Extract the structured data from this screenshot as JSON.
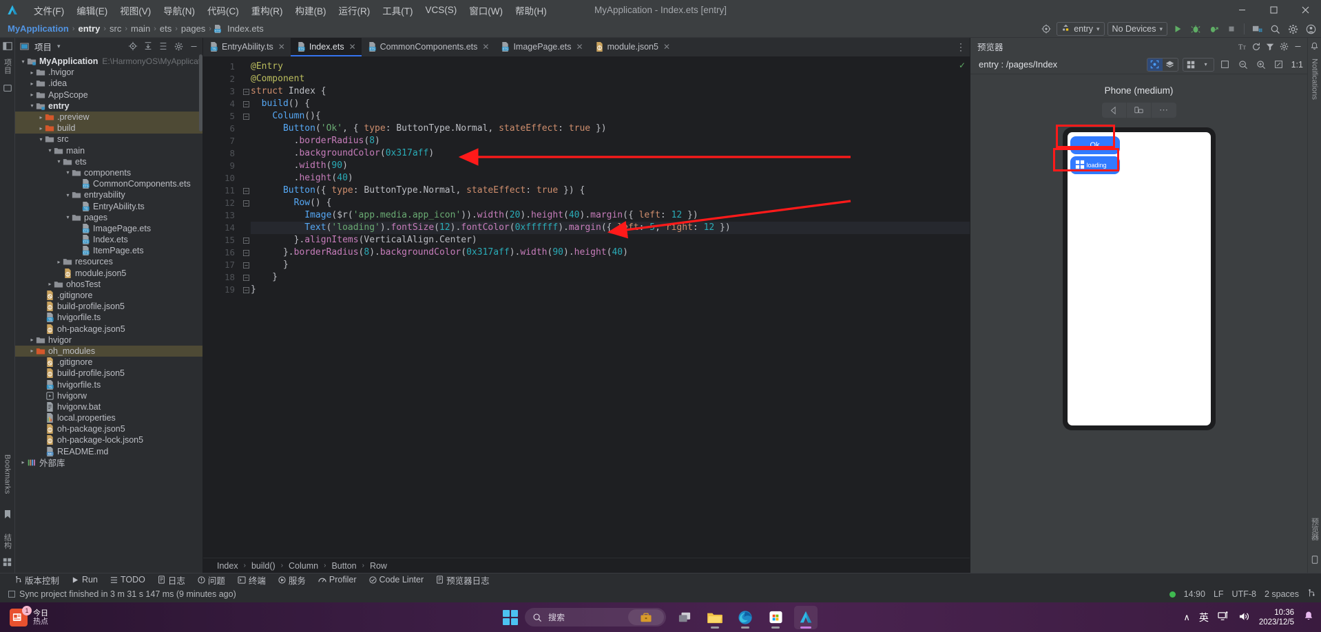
{
  "window": {
    "title": "MyApplication - Index.ets [entry]",
    "minimize": "–",
    "maximize": "☐",
    "close": "✕"
  },
  "menubar": {
    "items": [
      {
        "label": "文件(F)"
      },
      {
        "label": "编辑(E)"
      },
      {
        "label": "视图(V)"
      },
      {
        "label": "导航(N)"
      },
      {
        "label": "代码(C)"
      },
      {
        "label": "重构(R)"
      },
      {
        "label": "构建(B)"
      },
      {
        "label": "运行(R)"
      },
      {
        "label": "工具(T)"
      },
      {
        "label": "VCS(S)"
      },
      {
        "label": "窗口(W)"
      },
      {
        "label": "帮助(H)"
      }
    ]
  },
  "navbar": {
    "breadcrumbs": [
      "MyApplication",
      "entry",
      "src",
      "main",
      "ets",
      "pages",
      "Index.ets"
    ],
    "separator": "›",
    "run_config": "entry",
    "device_select": "No Devices",
    "chevron": "▾"
  },
  "left_rail": {
    "project_label": "项目",
    "bookmarks_label": "Bookmarks",
    "structure_label": "结构"
  },
  "project_panel": {
    "title": "项目",
    "chevron": "▾",
    "tree": [
      {
        "depth": 0,
        "arrow": "⌄",
        "icon": "module",
        "label": "MyApplication",
        "bold": true,
        "path": "E:\\HarmonyOS\\MyApplicatio",
        "selected": false
      },
      {
        "depth": 1,
        "arrow": "›",
        "icon": "folder",
        "label": ".hvigor",
        "bold": false,
        "path": "",
        "selected": false
      },
      {
        "depth": 1,
        "arrow": "›",
        "icon": "folder",
        "label": ".idea",
        "bold": false,
        "path": "",
        "selected": false
      },
      {
        "depth": 1,
        "arrow": "›",
        "icon": "folder",
        "label": "AppScope",
        "bold": false,
        "path": "",
        "selected": false
      },
      {
        "depth": 1,
        "arrow": "⌄",
        "icon": "module",
        "label": "entry",
        "bold": true,
        "path": "",
        "selected": false
      },
      {
        "depth": 2,
        "arrow": "›",
        "icon": "folder-orange",
        "label": ".preview",
        "bold": false,
        "path": "",
        "selected": true
      },
      {
        "depth": 2,
        "arrow": "›",
        "icon": "folder-orange",
        "label": "build",
        "bold": false,
        "path": "",
        "selected": true
      },
      {
        "depth": 2,
        "arrow": "⌄",
        "icon": "folder",
        "label": "src",
        "bold": false,
        "path": "",
        "selected": false
      },
      {
        "depth": 3,
        "arrow": "⌄",
        "icon": "folder",
        "label": "main",
        "bold": false,
        "path": "",
        "selected": false
      },
      {
        "depth": 4,
        "arrow": "⌄",
        "icon": "folder",
        "label": "ets",
        "bold": false,
        "path": "",
        "selected": false
      },
      {
        "depth": 5,
        "arrow": "⌄",
        "icon": "folder",
        "label": "components",
        "bold": false,
        "path": "",
        "selected": false
      },
      {
        "depth": 6,
        "arrow": "",
        "icon": "ets",
        "label": "CommonComponents.ets",
        "bold": false,
        "path": "",
        "selected": false
      },
      {
        "depth": 5,
        "arrow": "⌄",
        "icon": "folder",
        "label": "entryability",
        "bold": false,
        "path": "",
        "selected": false
      },
      {
        "depth": 6,
        "arrow": "",
        "icon": "ts",
        "label": "EntryAbility.ts",
        "bold": false,
        "path": "",
        "selected": false
      },
      {
        "depth": 5,
        "arrow": "⌄",
        "icon": "folder",
        "label": "pages",
        "bold": false,
        "path": "",
        "selected": false
      },
      {
        "depth": 6,
        "arrow": "",
        "icon": "ets",
        "label": "ImagePage.ets",
        "bold": false,
        "path": "",
        "selected": false
      },
      {
        "depth": 6,
        "arrow": "",
        "icon": "ets",
        "label": "Index.ets",
        "bold": false,
        "path": "",
        "selected": false
      },
      {
        "depth": 6,
        "arrow": "",
        "icon": "ets",
        "label": "ItemPage.ets",
        "bold": false,
        "path": "",
        "selected": false
      },
      {
        "depth": 4,
        "arrow": "›",
        "icon": "folder",
        "label": "resources",
        "bold": false,
        "path": "",
        "selected": false
      },
      {
        "depth": 4,
        "arrow": "",
        "icon": "json5",
        "label": "module.json5",
        "bold": false,
        "path": "",
        "selected": false
      },
      {
        "depth": 3,
        "arrow": "›",
        "icon": "folder",
        "label": "ohosTest",
        "bold": false,
        "path": "",
        "selected": false
      },
      {
        "depth": 2,
        "arrow": "",
        "icon": "gitignore",
        "label": ".gitignore",
        "bold": false,
        "path": "",
        "selected": false
      },
      {
        "depth": 2,
        "arrow": "",
        "icon": "json5",
        "label": "build-profile.json5",
        "bold": false,
        "path": "",
        "selected": false
      },
      {
        "depth": 2,
        "arrow": "",
        "icon": "ts",
        "label": "hvigorfile.ts",
        "bold": false,
        "path": "",
        "selected": false
      },
      {
        "depth": 2,
        "arrow": "",
        "icon": "json5",
        "label": "oh-package.json5",
        "bold": false,
        "path": "",
        "selected": false
      },
      {
        "depth": 1,
        "arrow": "›",
        "icon": "folder",
        "label": "hvigor",
        "bold": false,
        "path": "",
        "selected": false
      },
      {
        "depth": 1,
        "arrow": "›",
        "icon": "folder-orange",
        "label": "oh_modules",
        "bold": false,
        "path": "",
        "selected": true
      },
      {
        "depth": 2,
        "arrow": "",
        "icon": "gitignore",
        "label": ".gitignore",
        "bold": false,
        "path": "",
        "selected": false
      },
      {
        "depth": 2,
        "arrow": "",
        "icon": "json5",
        "label": "build-profile.json5",
        "bold": false,
        "path": "",
        "selected": false
      },
      {
        "depth": 2,
        "arrow": "",
        "icon": "ts",
        "label": "hvigorfile.ts",
        "bold": false,
        "path": "",
        "selected": false
      },
      {
        "depth": 2,
        "arrow": "",
        "icon": "script",
        "label": "hvigorw",
        "bold": false,
        "path": "",
        "selected": false
      },
      {
        "depth": 2,
        "arrow": "",
        "icon": "bat",
        "label": "hvigorw.bat",
        "bold": false,
        "path": "",
        "selected": false
      },
      {
        "depth": 2,
        "arrow": "",
        "icon": "properties",
        "label": "local.properties",
        "bold": false,
        "path": "",
        "selected": false
      },
      {
        "depth": 2,
        "arrow": "",
        "icon": "json5",
        "label": "oh-package.json5",
        "bold": false,
        "path": "",
        "selected": false
      },
      {
        "depth": 2,
        "arrow": "",
        "icon": "json5",
        "label": "oh-package-lock.json5",
        "bold": false,
        "path": "",
        "selected": false
      },
      {
        "depth": 2,
        "arrow": "",
        "icon": "md",
        "label": "README.md",
        "bold": false,
        "path": "",
        "selected": false
      },
      {
        "depth": 0,
        "arrow": "›",
        "icon": "lib",
        "label": "外部库",
        "bold": false,
        "path": "",
        "selected": false
      }
    ]
  },
  "editor": {
    "tabs": [
      {
        "label": "EntryAbility.ts",
        "icon": "ts",
        "active": false
      },
      {
        "label": "Index.ets",
        "icon": "ets",
        "active": true
      },
      {
        "label": "CommonComponents.ets",
        "icon": "ets",
        "active": false
      },
      {
        "label": "ImagePage.ets",
        "icon": "ets",
        "active": false
      },
      {
        "label": "module.json5",
        "icon": "json5",
        "active": false
      }
    ],
    "tab_close": "✕",
    "more": "⋮",
    "line_count": 19,
    "lines": [
      "@Entry",
      "@Component",
      "struct Index {",
      "  build() {",
      "    Column(){",
      "      Button('Ok', { type: ButtonType.Normal, stateEffect: true })",
      "        .borderRadius(8)",
      "        .backgroundColor(0x317aff)",
      "        .width(90)",
      "        .height(40)",
      "      Button({ type: ButtonType.Normal, stateEffect: true }) {",
      "        Row() {",
      "          Image($r('app.media.app_icon')).width(20).height(40).margin({ left: 12 })",
      "          Text('loading').fontSize(12).fontColor(0xffffff).margin({ left: 5, right: 12 })",
      "        }.alignItems(VerticalAlign.Center)",
      "      }.borderRadius(8).backgroundColor(0x317aff).width(90).height(40)",
      "      }",
      "    }",
      "}"
    ],
    "highlighted_line": 14,
    "breadcrumbs": [
      "Index",
      "build()",
      "Column",
      "Button",
      "Row"
    ],
    "breadcrumb_sep": "›",
    "inspection_ok": "✓"
  },
  "preview": {
    "title": "预览器",
    "route": "entry : /pages/Index",
    "device_title": "Phone (medium)",
    "zoom_label": "1:1",
    "buttons": {
      "ok": "Ok",
      "loading": "loading"
    },
    "nav_back": "◁",
    "rotate": "❐",
    "more": "⋯",
    "notifications_label": "Notifications",
    "preview_vertical_label": "预览器"
  },
  "bottom_tools": {
    "items": [
      {
        "label": "版本控制",
        "icon": "branch-icon"
      },
      {
        "label": "Run",
        "icon": "play-icon"
      },
      {
        "label": "TODO",
        "icon": "list-icon"
      },
      {
        "label": "日志",
        "icon": "log-icon"
      },
      {
        "label": "问题",
        "icon": "warning-icon"
      },
      {
        "label": "终端",
        "icon": "terminal-icon"
      },
      {
        "label": "服务",
        "icon": "service-icon"
      },
      {
        "label": "Profiler",
        "icon": "profiler-icon"
      },
      {
        "label": "Code Linter",
        "icon": "linter-icon"
      },
      {
        "label": "预览器日志",
        "icon": "preview-log-icon"
      }
    ]
  },
  "statusbar": {
    "message": "Sync project finished in 3 m 31 s 147 ms (9 minutes ago)",
    "cursor_position": "14:90",
    "line_ending": "LF",
    "encoding": "UTF-8",
    "indent": "2 spaces",
    "branch_icon": "branch-icon"
  },
  "taskbar": {
    "news": {
      "title": "今日",
      "subtitle": "热点",
      "badge": "1"
    },
    "search_placeholder": "搜索",
    "tray": {
      "chevron": "∧",
      "ime": "英",
      "time": "10:36",
      "date": "2023/12/5"
    },
    "apps": [
      {
        "name": "task-view"
      },
      {
        "name": "file-explorer"
      },
      {
        "name": "edge-browser"
      },
      {
        "name": "microsoft-store"
      },
      {
        "name": "deveco-studio"
      }
    ]
  }
}
